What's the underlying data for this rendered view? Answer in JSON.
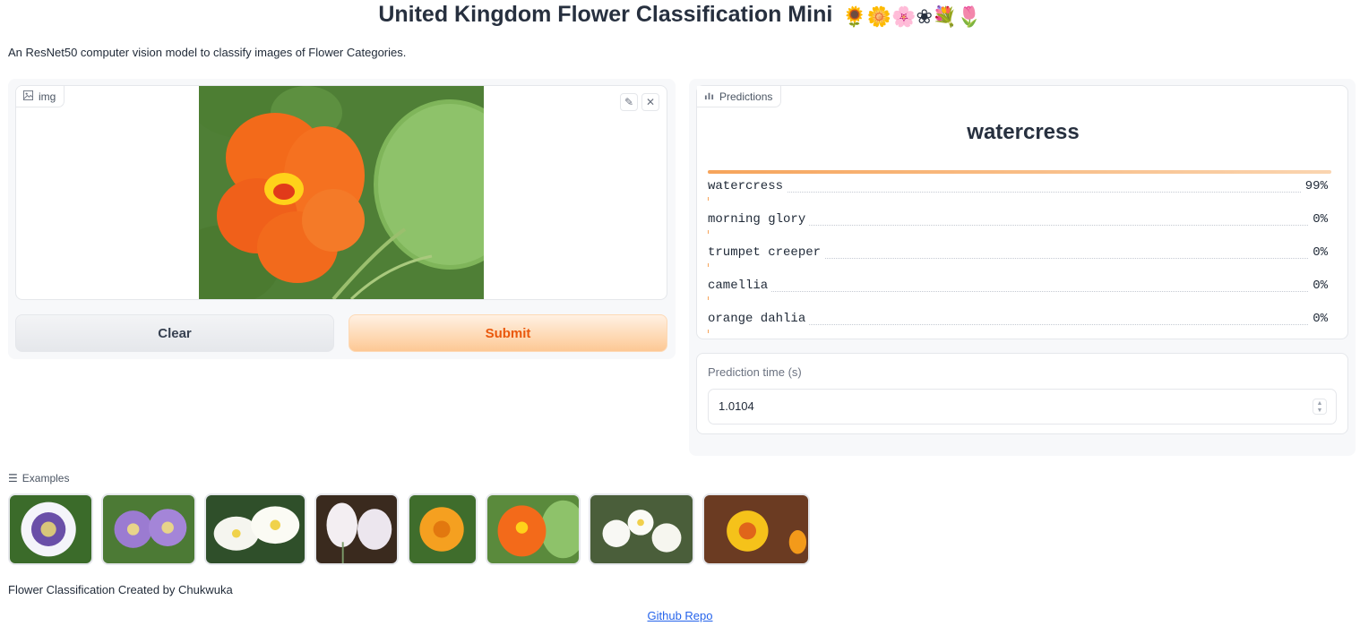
{
  "app": {
    "title": "United Kingdom Flower Classification Mini",
    "title_emojis": "🌻🌼🌸❀💐🌷",
    "description": "An ResNet50 computer vision model to classify images of Flower Categories."
  },
  "input": {
    "label": "img",
    "image_icon": "image-icon",
    "edit_icon": "pencil-icon",
    "close_icon": "close-icon"
  },
  "buttons": {
    "clear": "Clear",
    "submit": "Submit"
  },
  "predictions": {
    "label": "Predictions",
    "top_label": "watercress",
    "rows": [
      {
        "label": "watercress",
        "pct": "99%",
        "value": 0.99
      },
      {
        "label": "morning glory",
        "pct": "0%",
        "value": 0.0
      },
      {
        "label": "trumpet creeper",
        "pct": "0%",
        "value": 0.0
      },
      {
        "label": "camellia",
        "pct": "0%",
        "value": 0.0
      },
      {
        "label": "orange dahlia",
        "pct": "0%",
        "value": 0.0
      }
    ]
  },
  "prediction_time": {
    "label": "Prediction time (s)",
    "value": "1.0104"
  },
  "examples": {
    "label": "Examples",
    "items": [
      "passion-flower",
      "purple-passion-flower",
      "water-lily",
      "cyclamen",
      "orange-marigold",
      "nasturtium",
      "frangipani",
      "yellow-wallflower"
    ]
  },
  "footer": {
    "credit": "Flower Classification Created by Chukwuka",
    "link": "Github Repo"
  },
  "colors": {
    "accent": "#ea580c",
    "bar": "#f6a45b"
  }
}
